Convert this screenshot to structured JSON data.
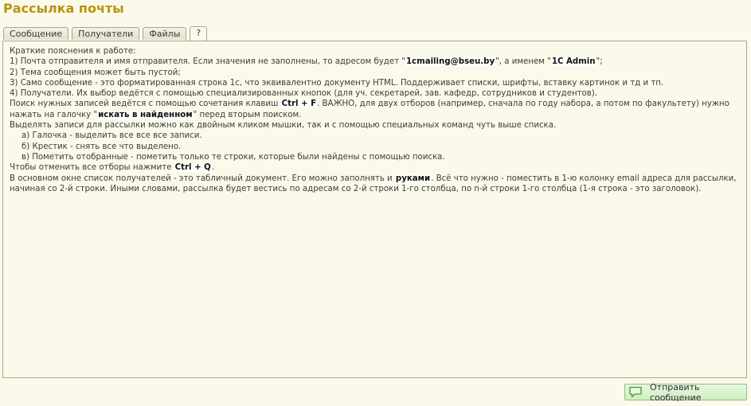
{
  "window": {
    "title": "Рассылка почты"
  },
  "tabs": [
    {
      "label": "Сообщение",
      "active": false
    },
    {
      "label": "Получатели",
      "active": false
    },
    {
      "label": "Файлы",
      "active": false
    },
    {
      "label": "?",
      "active": true
    }
  ],
  "help": {
    "intro": "Краткие пояснения к работе:",
    "item1_pre": "1) Почта отправителя и имя отправителя. Если значения не заполнены, то адресом будет \"",
    "item1_email": "1cmailing@bseu.by",
    "item1_mid": "\", а именем \"",
    "item1_name": "1C Admin",
    "item1_post": "\";",
    "item2": "2) Тема сообщения может быть пустой;",
    "item3": "3) Само сообщение - это форматированная строка 1с, что эквивалентно документу HTML. Поддерживает списки, шрифты, вставку картинок и тд и тп.",
    "item4": "4) Получатели. Их выбор ведётся с помощью специализированных кнопок (для уч. секретарей, зав. кафедр, сотрудников и студентов).",
    "search_pre": "Поиск нужных записей ведётся с помощью сочетания клавиш ",
    "search_key": "Ctrl + F",
    "search_post": ". ВАЖНО, для двух отборов (например, сначала по году набора, а потом по факультету) нужно нажать на галочку \"",
    "search_flag": "искать в найденном",
    "search_end": "\" перед вторым поиском.",
    "select_intro": "Выделять записи для рассылки можно как двойным кликом мышки, так и с помощью специальных команд чуть выше списка.",
    "select_a": "а) Галочка - выделить все все все записи.",
    "select_b": "б) Крестик - снять все что выделено.",
    "select_c": "в) Пометить отобранные - пометить только те строки, которые были найдены с помощью поиска.",
    "cancel_pre": "Чтобы отменить все отборы нажмите ",
    "cancel_key": "Ctrl + Q",
    "cancel_post": ".",
    "recipients_pre": "В основном окне список получателей - это табличный документ. Его можно заполнять и ",
    "recipients_hands": "руками",
    "recipients_post": ". Всё что нужно - поместить в 1-ю колонку email адреса для рассылки, начиная со 2-й строки. Иными словами, рассылка будет вестись по адресам со 2-й строки 1-го столбца, по n-й строки 1-го столбца (1-я строка - это заголовок)."
  },
  "footer": {
    "send_label": "Отправить сообщение",
    "send_icon": "speech-bubble-icon"
  },
  "colors": {
    "title": "#b89311",
    "background": "#fbf9e9",
    "button_border": "#8dbf7d"
  }
}
